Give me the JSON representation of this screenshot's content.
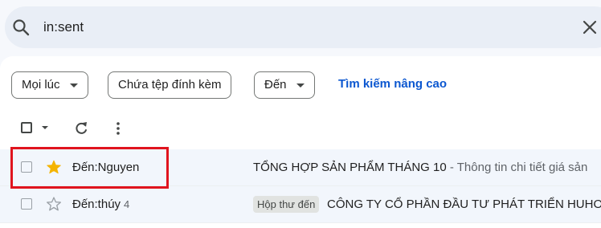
{
  "search": {
    "query": "in:sent"
  },
  "filters": {
    "time_label": "Mọi lúc",
    "attachment_label": "Chứa tệp đính kèm",
    "to_label": "Đến",
    "advanced_link": "Tìm kiếm nâng cao"
  },
  "icons": {
    "search": "search-icon",
    "close": "close-icon",
    "refresh": "refresh-icon",
    "more": "more-vert-icon",
    "star": "star-icon"
  },
  "colors": {
    "accent_link": "#0b57d0",
    "star_filled": "#f4b400",
    "highlight_border": "#e0141e"
  },
  "emails": [
    {
      "sender": "Đến:Nguyen",
      "count": "",
      "starred": true,
      "label": "",
      "subject": "TỔNG HỢP SẢN PHẨM THÁNG 10",
      "snippet": " - Thông tin chi tiết giá sản"
    },
    {
      "sender": "Đến:thúy",
      "count": "4",
      "starred": false,
      "label": "Hộp thư đến",
      "subject": "CÔNG TY CỔ PHẦN ĐẦU TƯ PHÁT TRIỂN HUHO",
      "snippet": ""
    }
  ]
}
